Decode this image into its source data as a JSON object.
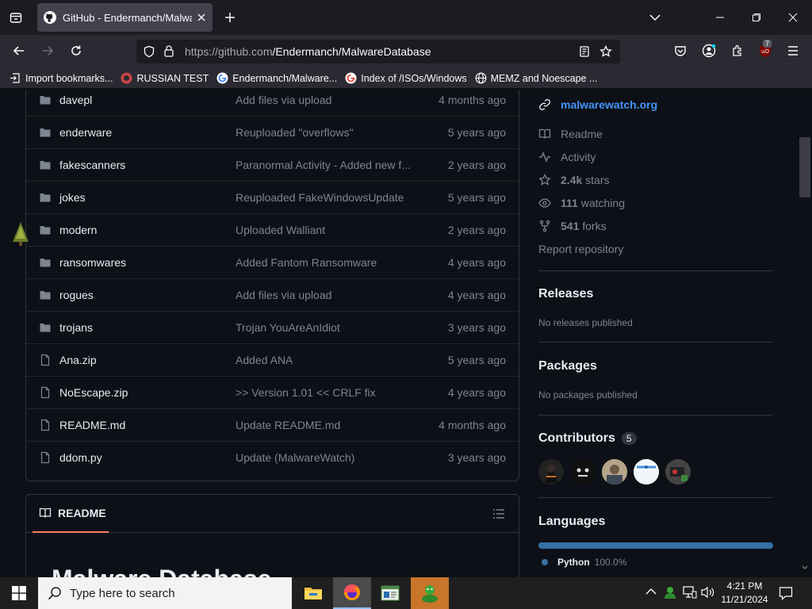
{
  "browser": {
    "tab_title": "GitHub - Endermanch/MalwareDatabase",
    "url_host": "https://github.com",
    "url_path": "/Endermanch/MalwareDatabase",
    "extension_badge": "7",
    "bookmarks": [
      {
        "label": "Import bookmarks...",
        "icon": "import-icon"
      },
      {
        "label": "RUSSIAN TEST",
        "icon": "github-icon"
      },
      {
        "label": "Endermanch/Malware...",
        "icon": "google-icon"
      },
      {
        "label": "Index of /ISOs/Windows",
        "icon": "google-icon"
      },
      {
        "label": "MEMZ and Noescape ...",
        "icon": "globe-icon"
      }
    ]
  },
  "files": [
    {
      "name": "davepl",
      "type": "folder",
      "message": "Add files via upload",
      "date": "4 months ago"
    },
    {
      "name": "enderware",
      "type": "folder",
      "message": "Reuploaded \"overflows\"",
      "date": "5 years ago"
    },
    {
      "name": "fakescanners",
      "type": "folder",
      "message": "Paranormal Activity - Added new f...",
      "date": "2 years ago"
    },
    {
      "name": "jokes",
      "type": "folder",
      "message": "Reuploaded FakeWindowsUpdate",
      "date": "5 years ago"
    },
    {
      "name": "modern",
      "type": "folder",
      "message": "Uploaded Walliant",
      "date": "2 years ago"
    },
    {
      "name": "ransomwares",
      "type": "folder",
      "message": "Added Fantom Ransomware",
      "date": "4 years ago"
    },
    {
      "name": "rogues",
      "type": "folder",
      "message": "Add files via upload",
      "date": "4 years ago"
    },
    {
      "name": "trojans",
      "type": "folder",
      "message": "Trojan YouAreAnIdiot",
      "date": "3 years ago"
    },
    {
      "name": "Ana.zip",
      "type": "file",
      "message": "Added ANA",
      "date": "5 years ago"
    },
    {
      "name": "NoEscape.zip",
      "type": "file",
      "message": ">> Version 1.01 << CRLF fix",
      "date": "4 years ago"
    },
    {
      "name": "README.md",
      "type": "file",
      "message": "Update README.md",
      "date": "4 months ago"
    },
    {
      "name": "ddom.py",
      "type": "file",
      "message": "Update (MalwareWatch)",
      "date": "3 years ago"
    }
  ],
  "readme": {
    "tab_label": "README",
    "title": "Malware Database"
  },
  "sidebar": {
    "website": "malwarewatch.org",
    "links": {
      "readme": "Readme",
      "activity": "Activity",
      "stars_count": "2.4k",
      "stars_label": "stars",
      "watching_count": "111",
      "watching_label": "watching",
      "forks_count": "541",
      "forks_label": "forks",
      "report": "Report repository"
    },
    "releases": {
      "title": "Releases",
      "subtitle": "No releases published"
    },
    "packages": {
      "title": "Packages",
      "subtitle": "No packages published"
    },
    "contributors": {
      "title": "Contributors",
      "count": "5"
    },
    "languages": {
      "title": "Languages",
      "name": "Python",
      "percent": "100.0%",
      "percent_value": 100,
      "color": "#3572A5"
    }
  },
  "taskbar": {
    "search_placeholder": "Type here to search",
    "time": "4:21 PM",
    "date": "11/21/2024"
  },
  "colors": {
    "link": "#4493f8",
    "text_muted": "#7d8590",
    "border": "#30363d",
    "readme_underline": "#f78166"
  }
}
